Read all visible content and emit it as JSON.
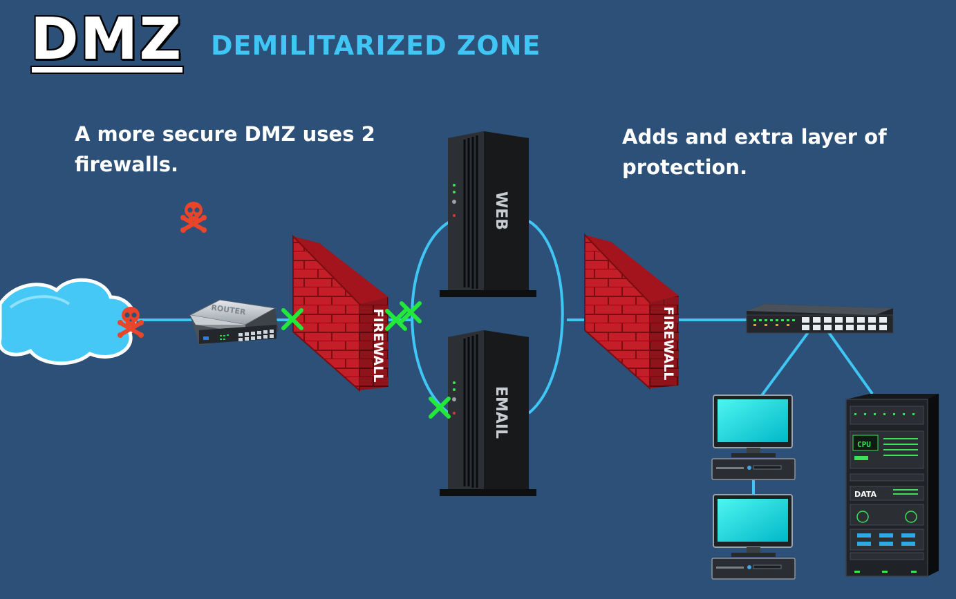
{
  "header": {
    "title": "DMZ",
    "subtitle": "DEMILITARIZED ZONE"
  },
  "notes": {
    "left": "A more secure DMZ uses 2 firewalls.",
    "right": "Adds and extra layer of protection."
  },
  "labels": {
    "router": "ROUTER",
    "firewall_outer": "FIREWALL",
    "firewall_inner": "FIREWALL",
    "web_server": "WEB",
    "email_server": "EMAIL",
    "rack_cpu": "CPU",
    "rack_data": "DATA"
  },
  "colors": {
    "background": "#2c5077",
    "link": "#3fc6f5",
    "firewall": "#c0202a",
    "blocked_marker": "#22e83a",
    "threat": "#e8452a"
  },
  "icons": {
    "internet": "cloud-icon",
    "threat": "skull-crossbones-icon",
    "blocked": "green-x-icon"
  }
}
